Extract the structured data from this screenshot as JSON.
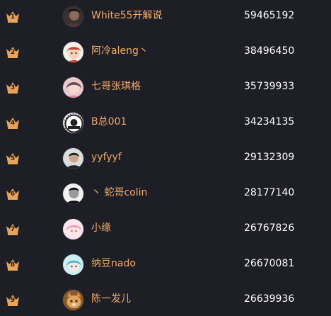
{
  "leaderboard": {
    "accent_color": "#f2a96a",
    "crown_color": "#e8a25a",
    "rows": [
      {
        "rank": "1",
        "name": "White55开解说",
        "score": "59465192",
        "avatar_icon": "avatar-dark-portrait"
      },
      {
        "rank": "2",
        "name": "阿冷aleng丶",
        "score": "38496450",
        "avatar_icon": "avatar-cartoon-girl"
      },
      {
        "rank": "3",
        "name": "七哥张琪格",
        "score": "35739933",
        "avatar_icon": "avatar-pink-portrait"
      },
      {
        "rank": "4",
        "name": "B总001",
        "score": "34234135",
        "avatar_icon": "avatar-badge-logo"
      },
      {
        "rank": "5",
        "name": "yyfyyf",
        "score": "29132309",
        "avatar_icon": "avatar-person"
      },
      {
        "rank": "6",
        "name": "丶 蛇哥colin",
        "score": "28177140",
        "avatar_icon": "avatar-bw-portrait"
      },
      {
        "rank": "7",
        "name": "小缘",
        "score": "26767826",
        "avatar_icon": "avatar-anime-pink"
      },
      {
        "rank": "8",
        "name": "纳豆nado",
        "score": "26670081",
        "avatar_icon": "avatar-anime-teal"
      },
      {
        "rank": "9",
        "name": "陈一发儿",
        "score": "26639936",
        "avatar_icon": "avatar-cat"
      }
    ]
  }
}
